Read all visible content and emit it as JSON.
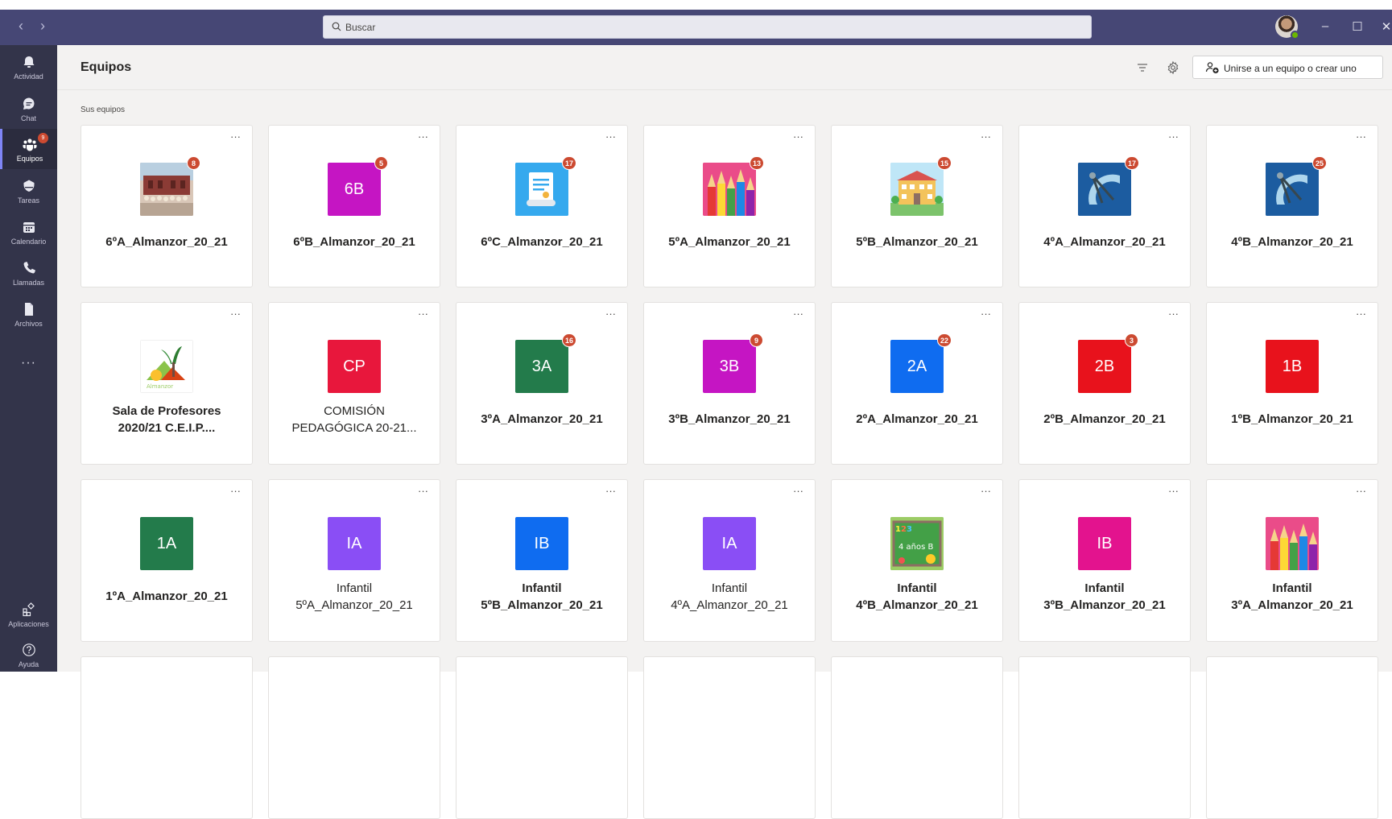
{
  "search": {
    "placeholder": "Buscar"
  },
  "rail": {
    "items": [
      {
        "label": "Actividad",
        "icon": "bell-icon"
      },
      {
        "label": "Chat",
        "icon": "chat-icon"
      },
      {
        "label": "Equipos",
        "icon": "teams-icon",
        "badge": "9"
      },
      {
        "label": "Tareas",
        "icon": "assignments-icon"
      },
      {
        "label": "Calendario",
        "icon": "calendar-icon"
      },
      {
        "label": "Llamadas",
        "icon": "phone-icon"
      },
      {
        "label": "Archivos",
        "icon": "file-icon"
      }
    ],
    "more": "···",
    "bottom": [
      {
        "label": "Aplicaciones",
        "icon": "apps-icon"
      },
      {
        "label": "Ayuda",
        "icon": "help-icon"
      }
    ]
  },
  "header": {
    "title": "Equipos",
    "join_label": "Unirse a un equipo o crear uno"
  },
  "section_label": "Sus equipos",
  "teams": [
    {
      "line1": "6ºA_Almanzor_20_21",
      "line2": "",
      "bold": true,
      "tile": "",
      "tile_color": "#8b5a4a",
      "image": "photo-school-group",
      "badge": "8"
    },
    {
      "line1": "6ºB_Almanzor_20_21",
      "line2": "",
      "bold": true,
      "tile": "6B",
      "tile_color": "#c515c3",
      "image": "",
      "badge": "5"
    },
    {
      "line1": "6ºC_Almanzor_20_21",
      "line2": "",
      "bold": true,
      "tile": "",
      "tile_color": "#35a9ee",
      "image": "scroll-document",
      "badge": "17"
    },
    {
      "line1": "5ºA_Almanzor_20_21",
      "line2": "",
      "bold": true,
      "tile": "",
      "tile_color": "#e74c8e",
      "image": "colored-pencils",
      "badge": "13"
    },
    {
      "line1": "5ºB_Almanzor_20_21",
      "line2": "",
      "bold": true,
      "tile": "",
      "tile_color": "#9ed6f0",
      "image": "school-building",
      "badge": "15"
    },
    {
      "line1": "4ºA_Almanzor_20_21",
      "line2": "",
      "bold": true,
      "tile": "",
      "tile_color": "#1c5ca0",
      "image": "protractor-compass",
      "badge": "17"
    },
    {
      "line1": "4ºB_Almanzor_20_21",
      "line2": "",
      "bold": true,
      "tile": "",
      "tile_color": "#1c5ca0",
      "image": "protractor-compass",
      "badge": "25"
    },
    {
      "line1": "Sala de Profesores",
      "line2": "2020/21 C.E.I.P....",
      "bold": true,
      "tile": "",
      "tile_color": "#ffffff",
      "image": "school-logo",
      "badge": ""
    },
    {
      "line1": "COMISIÓN",
      "line2": "PEDAGÓGICA 20-21...",
      "bold": false,
      "tile": "CP",
      "tile_color": "#e8173c",
      "image": "",
      "badge": ""
    },
    {
      "line1": "3ºA_Almanzor_20_21",
      "line2": "",
      "bold": true,
      "tile": "3A",
      "tile_color": "#237b4b",
      "image": "",
      "badge": "16"
    },
    {
      "line1": "3ºB_Almanzor_20_21",
      "line2": "",
      "bold": true,
      "tile": "3B",
      "tile_color": "#c515c3",
      "image": "",
      "badge": "9"
    },
    {
      "line1": "2ºA_Almanzor_20_21",
      "line2": "",
      "bold": true,
      "tile": "2A",
      "tile_color": "#0f6cf0",
      "image": "",
      "badge": "22"
    },
    {
      "line1": "2ºB_Almanzor_20_21",
      "line2": "",
      "bold": true,
      "tile": "2B",
      "tile_color": "#e8121c",
      "image": "",
      "badge": "3"
    },
    {
      "line1": "1ºB_Almanzor_20_21",
      "line2": "",
      "bold": true,
      "tile": "1B",
      "tile_color": "#e8121c",
      "image": "",
      "badge": ""
    },
    {
      "line1": "1ºA_Almanzor_20_21",
      "line2": "",
      "bold": true,
      "tile": "1A",
      "tile_color": "#237b4b",
      "image": "",
      "badge": ""
    },
    {
      "line1": "Infantil",
      "line2": "5ºA_Almanzor_20_21",
      "bold": false,
      "tile": "IA",
      "tile_color": "#8a4ef5",
      "image": "",
      "badge": ""
    },
    {
      "line1": "Infantil",
      "line2": "5ºB_Almanzor_20_21",
      "bold": true,
      "tile": "IB",
      "tile_color": "#0f6cf0",
      "image": "",
      "badge": ""
    },
    {
      "line1": "Infantil",
      "line2": "4ºA_Almanzor_20_21",
      "bold": false,
      "tile": "IA",
      "tile_color": "#8a4ef5",
      "image": "",
      "badge": ""
    },
    {
      "line1": "Infantil",
      "line2": "4ºB_Almanzor_20_21",
      "bold": true,
      "tile": "",
      "tile_color": "#6fbf73",
      "image": "chalkboard",
      "badge": ""
    },
    {
      "line1": "Infantil",
      "line2": "3ºB_Almanzor_20_21",
      "bold": true,
      "tile": "IB",
      "tile_color": "#e3138e",
      "image": "",
      "badge": ""
    },
    {
      "line1": "Infantil",
      "line2": "3ºA_Almanzor_20_21",
      "bold": true,
      "tile": "",
      "tile_color": "#e74c8e",
      "image": "colored-pencils",
      "badge": ""
    }
  ],
  "more_label": "···"
}
